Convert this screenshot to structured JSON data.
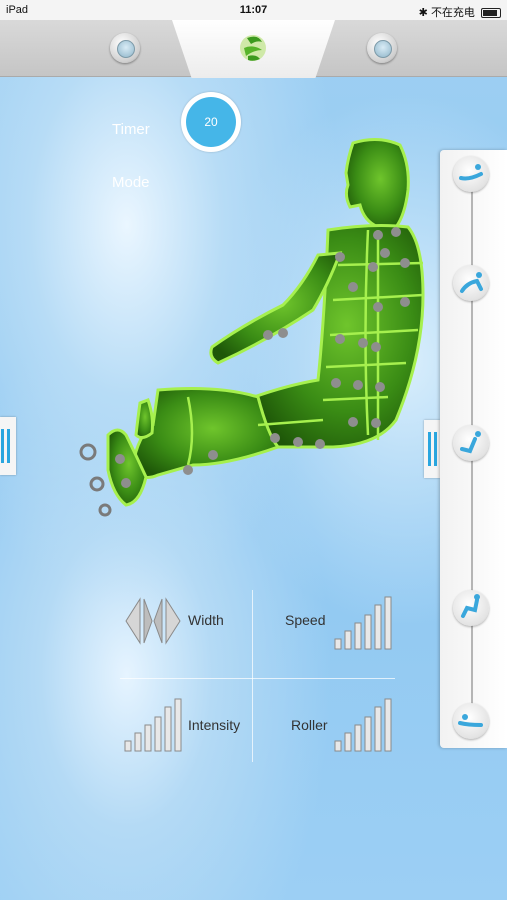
{
  "status_bar": {
    "device": "iPad",
    "time": "11:07",
    "charging_text": "不在充电"
  },
  "header": {
    "left_button_icon": "power-icon",
    "center_logo_icon": "massage-logo-icon",
    "right_button_icon": "power-icon"
  },
  "timer": {
    "label": "Timer",
    "value": "20"
  },
  "mode": {
    "label": "Mode"
  },
  "controls": {
    "width_label": "Width",
    "speed_label": "Speed",
    "intensity_label": "Intensity",
    "roller_label": "Roller"
  },
  "recline_positions": [
    "recline-position-1-icon",
    "recline-position-2-icon",
    "recline-position-3-icon",
    "recline-position-4-icon",
    "recline-position-5-icon"
  ],
  "colors": {
    "accent_blue": "#45b6e8",
    "body_green": "#2e7d12",
    "outline_green": "#9fe34a"
  }
}
